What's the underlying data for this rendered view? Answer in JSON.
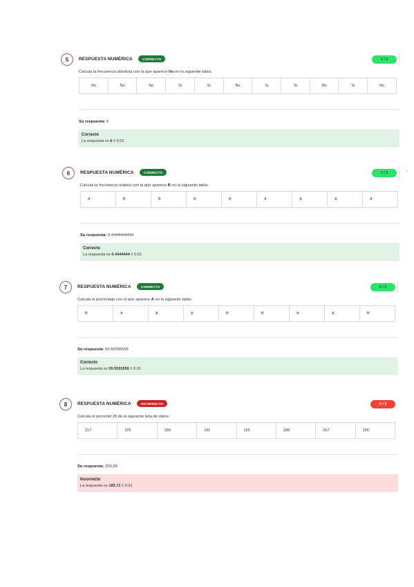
{
  "questions": [
    {
      "number": "5",
      "type": "RESPUESTA NUMÉRICA",
      "badge": "CORRECTO",
      "status": "ok",
      "score": "1 / 1",
      "prompt_before": "Calcula la frecuencia absoluta con la que aparece",
      "prompt_bold": "No",
      "prompt_after": "en la siguiente tabla:",
      "cells": [
        "No",
        "No",
        "No",
        "Si",
        "Si",
        "No",
        "Si",
        "Si",
        "No",
        "Si",
        "No"
      ],
      "answer_label": "Su respuesta:",
      "answer_value": "6",
      "feedback_title": "Correcto",
      "feedback_prefix": "La respuesta es",
      "feedback_value": "6",
      "feedback_suffix": "± 0.01"
    },
    {
      "number": "6",
      "type": "RESPUESTA NUMÉRICA",
      "badge": "CORRECTO",
      "status": "ok",
      "score": "1 / 1",
      "prompt_before": "Calcula la frecuencia relativa con la que aparece",
      "prompt_bold": "B",
      "prompt_after": "en la siguiente tabla:",
      "cells": [
        "A",
        "B",
        "B",
        "B",
        "B",
        "A",
        "A",
        "A",
        "A"
      ],
      "answer_label": "Su respuesta:",
      "answer_value": "0,4444444444",
      "feedback_title": "Correcto",
      "feedback_prefix": "La respuesta es",
      "feedback_value": "0.4444444",
      "feedback_suffix": "± 0.01"
    },
    {
      "number": "7",
      "type": "RESPUESTA NUMÉRICA",
      "badge": "CORRECTO",
      "status": "ok",
      "score": "1 / 1",
      "prompt_before": "Calcula el porcentaje con el que aparece",
      "prompt_bold": "A",
      "prompt_after": "en la siguiente tabla:",
      "cells": [
        "B",
        "A",
        "A",
        "A",
        "B",
        "B",
        "A",
        "A",
        "B"
      ],
      "answer_label": "Su respuesta:",
      "answer_value": "55,55555556",
      "feedback_title": "Correcto",
      "feedback_prefix": "La respuesta es",
      "feedback_value": "55.5555556",
      "feedback_suffix": "± 0.01"
    },
    {
      "number": "8",
      "type": "RESPUESTA NUMÉRICA",
      "badge": "INCORRECTO",
      "status": "bad",
      "score": "0 / 1",
      "prompt_before": "Calcula el percentil 28 de la siguiente lista de datos:",
      "prompt_bold": "",
      "prompt_after": "",
      "cells": [
        "217",
        "226",
        "180",
        "191",
        "165",
        "288",
        "267",
        "195"
      ],
      "answer_label": "Su respuesta:",
      "answer_value": "203,28",
      "feedback_title": "Incorrecto",
      "feedback_prefix": "La respuesta es",
      "feedback_value": "185.72",
      "feedback_suffix": "± 0.01"
    }
  ],
  "stray_mark": "‹"
}
